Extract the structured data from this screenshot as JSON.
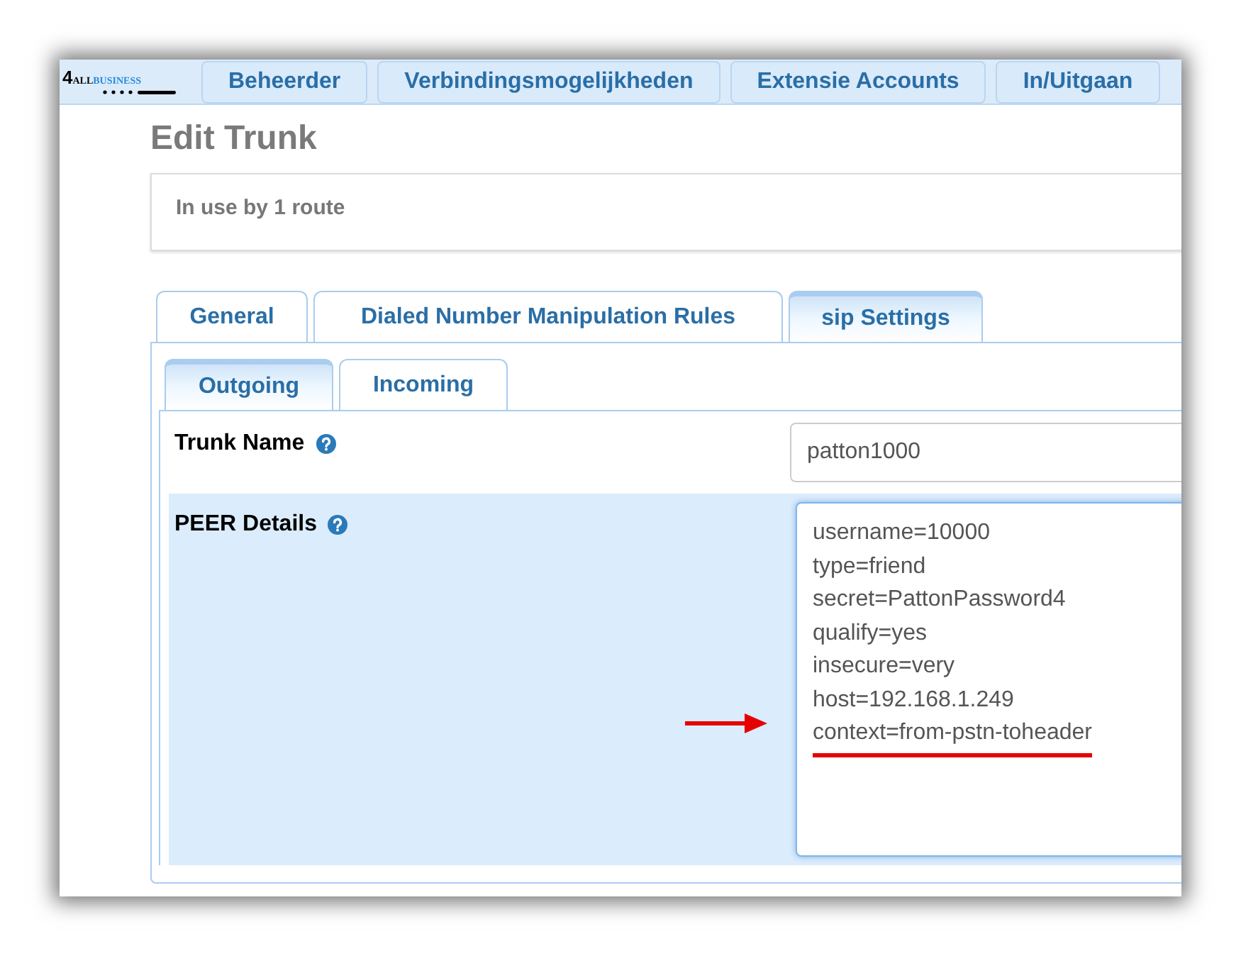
{
  "logo": {
    "numeral": "4",
    "word_1": "ALL",
    "word_2": "BUSINESS"
  },
  "nav": [
    {
      "label": "Beheerder"
    },
    {
      "label": "Verbindingsmogelijkheden"
    },
    {
      "label": "Extensie Accounts"
    },
    {
      "label": "In/Uitgaan"
    }
  ],
  "page_title": "Edit Trunk",
  "usage_note": "In use by 1 route",
  "tabs": [
    {
      "label": "General",
      "selected": false
    },
    {
      "label": "Dialed Number Manipulation Rules",
      "selected": false
    },
    {
      "label": "sip Settings",
      "selected": true
    }
  ],
  "subtabs": [
    {
      "label": "Outgoing",
      "selected": true
    },
    {
      "label": "Incoming",
      "selected": false
    }
  ],
  "trunk_name": {
    "label": "Trunk Name",
    "value": "patton1000"
  },
  "peer_details": {
    "label": "PEER Details",
    "lines": [
      {
        "text": "username=10000",
        "highlighted": false
      },
      {
        "text": "type=friend",
        "highlighted": false
      },
      {
        "text": "secret=PattonPassword4",
        "highlighted": false
      },
      {
        "text": "qualify=yes",
        "highlighted": false
      },
      {
        "text": "insecure=very",
        "highlighted": false
      },
      {
        "text": "host=192.168.1.249",
        "highlighted": false
      },
      {
        "text": "context=from-pstn-toheader",
        "highlighted": true
      }
    ]
  }
}
